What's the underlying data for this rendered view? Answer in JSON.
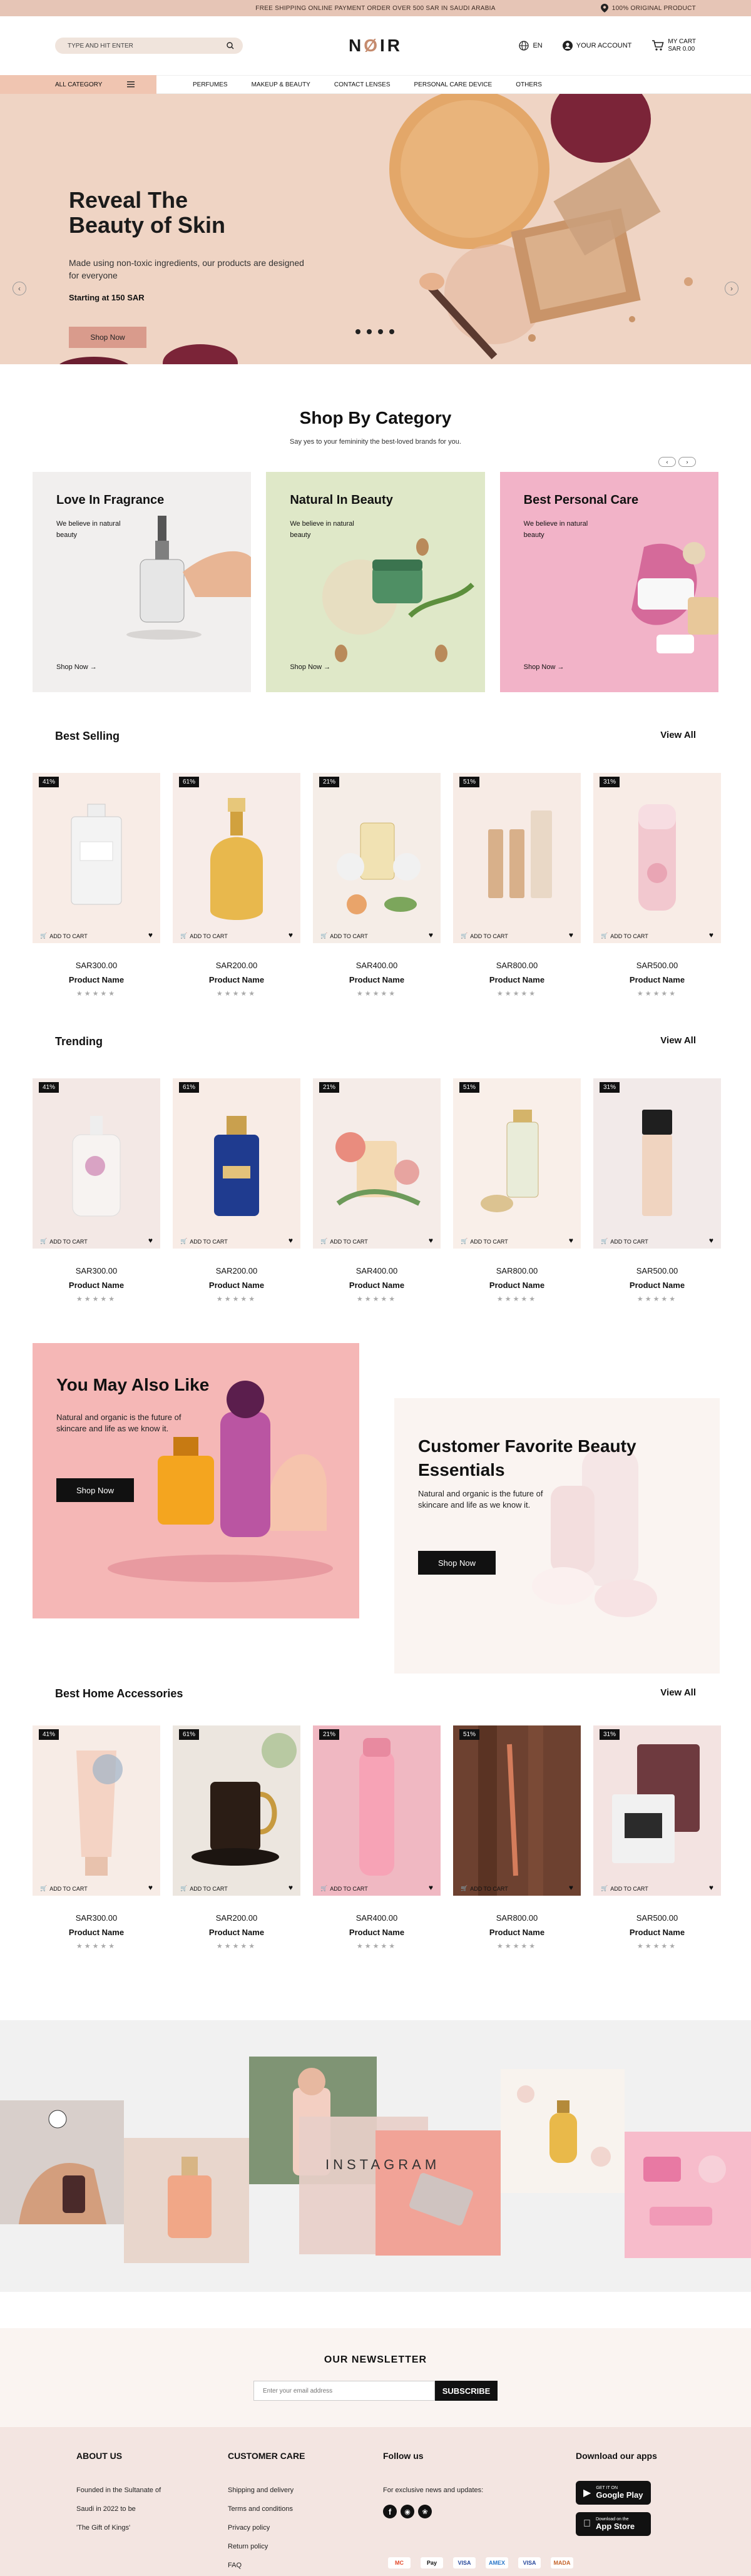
{
  "topbar": {
    "shipping": "FREE SHIPPING ONLINE PAYMENT ORDER OVER 500 SAR IN SAUDI ARABIA",
    "original": "100% ORIGINAL PRODUCT"
  },
  "header": {
    "search_placeholder": "TYPE AND HIT ENTER",
    "logo_prefix": "N",
    "logo_o": "Ø",
    "logo_suffix": "IR",
    "lang": "EN",
    "account": "YOUR ACCOUNT",
    "cart_title": "MY CART",
    "cart_total": "SAR 0.00"
  },
  "nav": {
    "all_category": "ALL CATEGORY",
    "links": [
      "PERFUMES",
      "MAKEUP & BEAUTY",
      "CONTACT LENSES",
      "PERSONAL CARE DEVICE",
      "OTHERS"
    ]
  },
  "hero": {
    "title_line1": "Reveal The",
    "title_line2": "Beauty of Skin",
    "description": "Made using non-toxic ingredients, our products are designed for everyone",
    "price": "Starting at 150 SAR",
    "button": "Shop Now"
  },
  "category_section": {
    "title": "Shop By Category",
    "subtitle": "Say yes to your femininity the best-loved brands for you.",
    "cards": [
      {
        "title": "Love In Fragrance",
        "desc": "We believe in natural beauty",
        "link": "Shop Now →",
        "bg": "#f1efee"
      },
      {
        "title": "Natural In Beauty",
        "desc": "We believe in natural beauty",
        "link": "Shop Now →",
        "bg": "#dfe8c8"
      },
      {
        "title": "Best Personal Care",
        "desc": "We believe in natural beauty",
        "link": "Shop Now →",
        "bg": "#f2b3c8"
      }
    ]
  },
  "best_selling": {
    "title": "Best Selling",
    "view_all": "View All",
    "products": [
      {
        "discount": "41%",
        "price": "SAR300.00",
        "name": "Product Name"
      },
      {
        "discount": "61%",
        "price": "SAR200.00",
        "name": "Product Name"
      },
      {
        "discount": "21%",
        "price": "SAR400.00",
        "name": "Product Name"
      },
      {
        "discount": "51%",
        "price": "SAR800.00",
        "name": "Product Name"
      },
      {
        "discount": "31%",
        "price": "SAR500.00",
        "name": "Product Name"
      }
    ]
  },
  "trending": {
    "title": "Trending",
    "view_all": "View All",
    "products": [
      {
        "discount": "41%",
        "price": "SAR300.00",
        "name": "Product Name"
      },
      {
        "discount": "61%",
        "price": "SAR200.00",
        "name": "Product Name"
      },
      {
        "discount": "21%",
        "price": "SAR400.00",
        "name": "Product Name"
      },
      {
        "discount": "51%",
        "price": "SAR800.00",
        "name": "Product Name"
      },
      {
        "discount": "31%",
        "price": "SAR500.00",
        "name": "Product Name"
      }
    ]
  },
  "promo": {
    "left": {
      "title": "You May Also Like",
      "desc": "Natural and organic is the future of skincare and life as we know it.",
      "button": "Shop Now"
    },
    "right": {
      "title_line1": "Customer Favorite Beauty",
      "title_line2": "Essentials",
      "desc": "Natural and organic is the future of skincare and life as we know it.",
      "button": "Shop Now"
    }
  },
  "home_accessories": {
    "title": "Best Home Accessories",
    "view_all": "View All",
    "products": [
      {
        "discount": "41%",
        "price": "SAR300.00",
        "name": "Product Name"
      },
      {
        "discount": "61%",
        "price": "SAR200.00",
        "name": "Product Name"
      },
      {
        "discount": "21%",
        "price": "SAR400.00",
        "name": "Product Name"
      },
      {
        "discount": "51%",
        "price": "SAR800.00",
        "name": "Product Name"
      },
      {
        "discount": "31%",
        "price": "SAR500.00",
        "name": "Product Name"
      }
    ]
  },
  "product_ui": {
    "add_to_cart": "ADD TO CART",
    "stars": "★★★★★"
  },
  "instagram": {
    "label": "INSTAGRAM"
  },
  "newsletter": {
    "title": "OUR NEWSLETTER",
    "placeholder": "Enter your email address",
    "button": "SUBSCRIBE"
  },
  "footer": {
    "about": {
      "title": "ABOUT US",
      "lines": [
        "Founded in the Sultanate of",
        "Saudi in 2022 to be",
        "'The Gift of Kings'"
      ]
    },
    "care": {
      "title": "CUSTOMER CARE",
      "links": [
        "Shipping and delivery",
        "Terms and conditions",
        "Privacy policy",
        "Return policy",
        "FAQ"
      ]
    },
    "follow": {
      "title": "Follow us",
      "text": "For exclusive news and updates:"
    },
    "apps": {
      "title": "Download our apps",
      "google_top": "GET IT ON",
      "google": "Google Play",
      "apple_top": "Download on the",
      "apple": "App Store"
    },
    "payments": [
      "MC",
      "Pay",
      "VISA",
      "AMEX",
      "VISA",
      "MADA"
    ]
  }
}
